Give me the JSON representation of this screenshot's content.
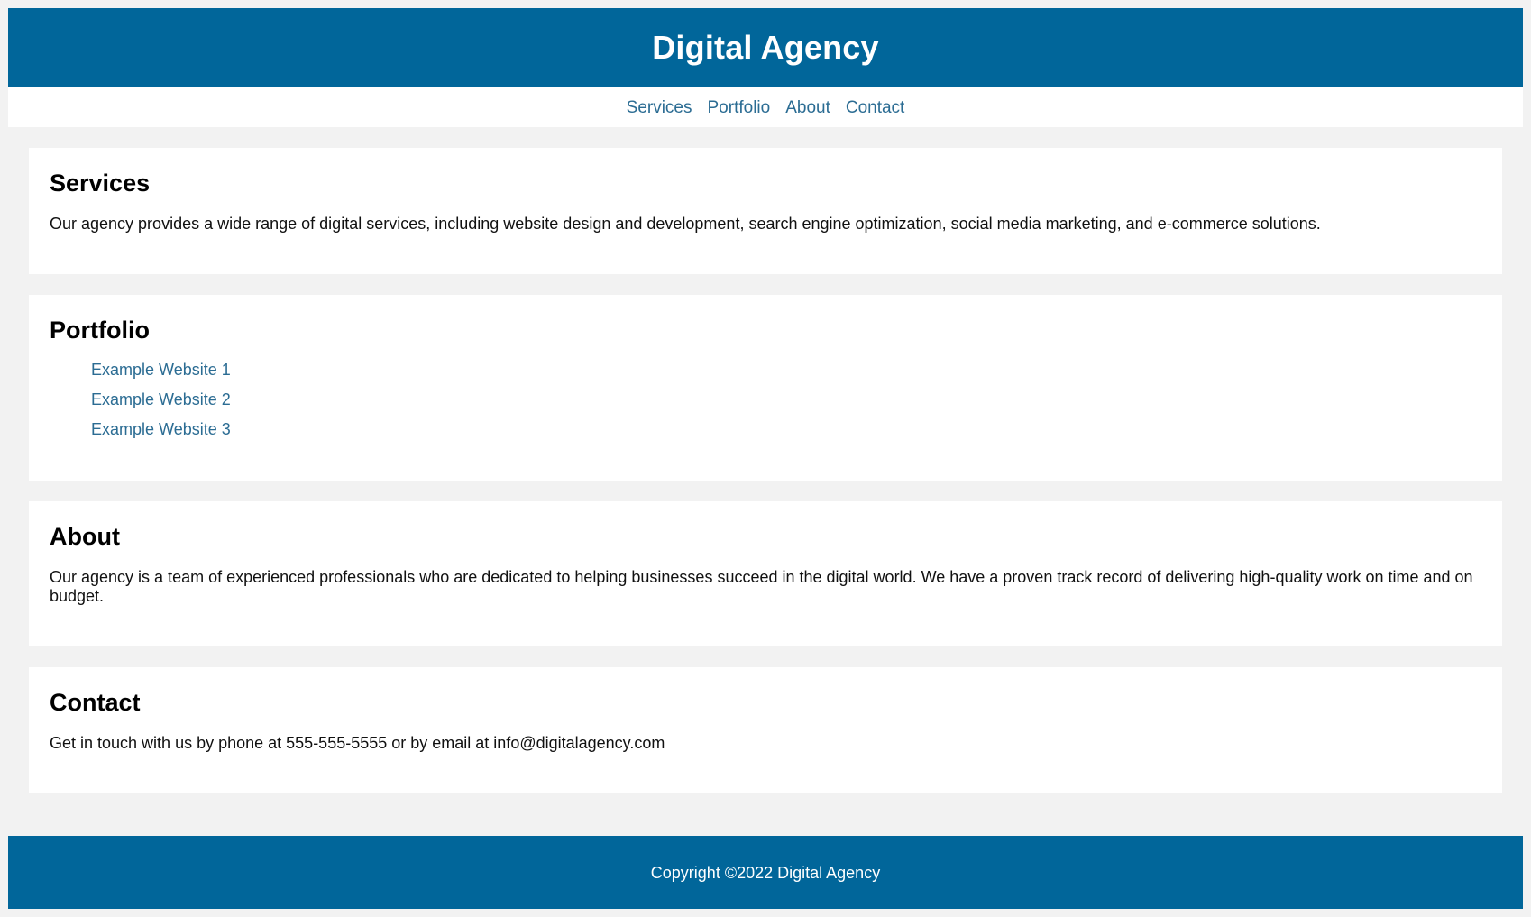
{
  "header": {
    "title": "Digital Agency"
  },
  "nav": {
    "items": [
      {
        "label": "Services"
      },
      {
        "label": "Portfolio"
      },
      {
        "label": "About"
      },
      {
        "label": "Contact"
      }
    ]
  },
  "sections": {
    "services": {
      "heading": "Services",
      "text": "Our agency provides a wide range of digital services, including website design and development, search engine optimization, social media marketing, and e-commerce solutions."
    },
    "portfolio": {
      "heading": "Portfolio",
      "links": [
        {
          "label": "Example Website 1"
        },
        {
          "label": "Example Website 2"
        },
        {
          "label": "Example Website 3"
        }
      ]
    },
    "about": {
      "heading": "About",
      "text": "Our agency is a team of experienced professionals who are dedicated to helping businesses succeed in the digital world. We have a proven track record of delivering high-quality work on time and on budget."
    },
    "contact": {
      "heading": "Contact",
      "text": "Get in touch with us by phone at 555-555-5555 or by email at info@digitalagency.com"
    }
  },
  "footer": {
    "copyright": "Copyright ©2022 Digital Agency"
  },
  "colors": {
    "brand": "#01669a",
    "link": "#2b6c93",
    "background": "#f2f2f2",
    "card": "#ffffff"
  }
}
